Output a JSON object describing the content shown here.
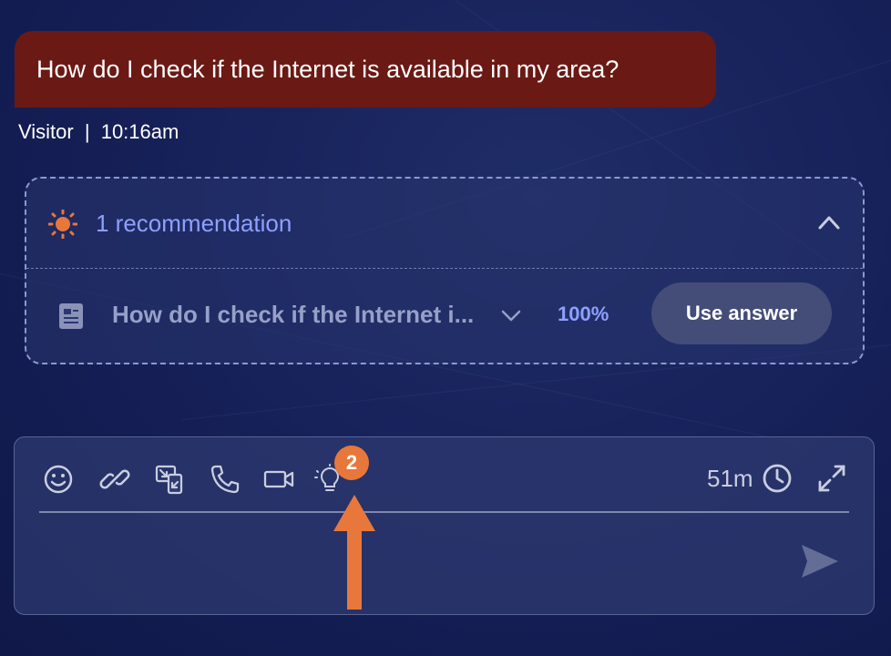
{
  "message": {
    "text": "How do I check if the Internet is available in my area?",
    "sender": "Visitor",
    "separator": "|",
    "time": "10:16am"
  },
  "recommendations": {
    "title": "1 recommendation",
    "items": [
      {
        "text": "How do I check if the Internet i...",
        "confidence": "100%",
        "action_label": "Use answer"
      }
    ]
  },
  "composer": {
    "tools": [
      "emoji-icon",
      "link-icon",
      "screen-share-icon",
      "phone-icon",
      "video-icon",
      "lightbulb-icon"
    ],
    "annotation_badge": "2",
    "timer": "51m",
    "input_value": ""
  },
  "colors": {
    "visitor_bubble": "#6b1914",
    "accent_blue": "#8ea0ff",
    "orange_accent": "#e8773b",
    "background": "#17215a"
  }
}
